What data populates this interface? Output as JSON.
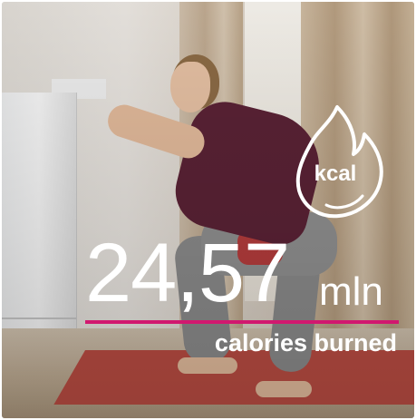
{
  "stat": {
    "value": "24,57",
    "unit": "mln",
    "caption": "calories burned"
  },
  "badge": {
    "label": "kcal",
    "icon": "flame-icon"
  },
  "colors": {
    "accent": "#d1186f",
    "text": "#ffffff"
  }
}
